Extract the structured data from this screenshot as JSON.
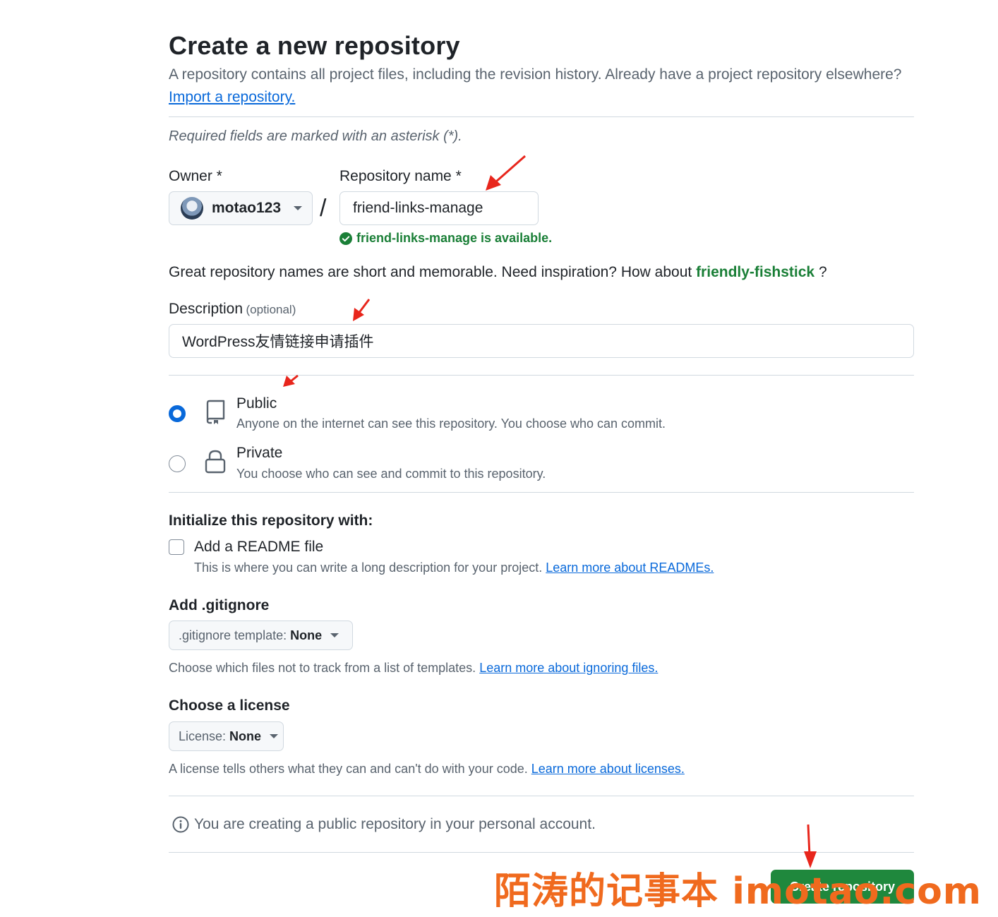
{
  "header": {
    "title": "Create a new repository",
    "subtitle": "A repository contains all project files, including the revision history. Already have a project repository elsewhere?",
    "import_link": "Import a repository."
  },
  "required_note": "Required fields are marked with an asterisk (*).",
  "owner": {
    "label": "Owner *",
    "value": "motao123"
  },
  "separator": "/",
  "repo_name": {
    "label": "Repository name *",
    "value": "friend-links-manage",
    "availability": "friend-links-manage is available."
  },
  "suggestion": {
    "text": "Great repository names are short and memorable. Need inspiration? How about",
    "name": "friendly-fishstick",
    "suffix": "?"
  },
  "description": {
    "label": "Description",
    "optional": "(optional)",
    "value": "WordPress友情链接申请插件"
  },
  "visibility": {
    "public": {
      "title": "Public",
      "desc": "Anyone on the internet can see this repository. You choose who can commit."
    },
    "private": {
      "title": "Private",
      "desc": "You choose who can see and commit to this repository."
    },
    "selected": "public"
  },
  "initialize": {
    "heading": "Initialize this repository with:",
    "readme_label": "Add a README file",
    "readme_desc": "This is where you can write a long description for your project.",
    "readme_link": "Learn more about READMEs."
  },
  "gitignore": {
    "heading": "Add .gitignore",
    "select_prefix": ".gitignore template:",
    "select_value": "None",
    "desc": "Choose which files not to track from a list of templates.",
    "link": "Learn more about ignoring files."
  },
  "license": {
    "heading": "Choose a license",
    "select_prefix": "License:",
    "select_value": "None",
    "desc": "A license tells others what they can and can't do with your code.",
    "link": "Learn more about licenses."
  },
  "notice": "You are creating a public repository in your personal account.",
  "create_button": "Create repository",
  "watermark": "陌涛的记事本 imotao.com",
  "colors": {
    "accent": "#0969da",
    "success": "#1a7f37",
    "button": "#1f883d",
    "annotation": "#e8261c",
    "watermark": "#f06a1e"
  }
}
